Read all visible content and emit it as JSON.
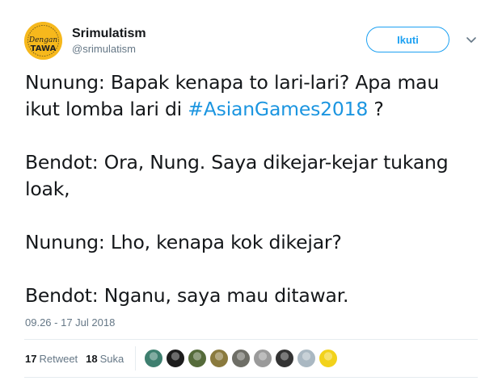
{
  "author": {
    "name": "Srimulatism",
    "handle": "@srimulatism",
    "avatar": {
      "line1": "Dengan",
      "line2": "TAWA",
      "bg": "#f6b81c",
      "ring": "#222222"
    }
  },
  "follow_label": "Ikuti",
  "more_icon": "chevron-down-icon",
  "tweet": {
    "line1": "Nunung: Bapak kenapa to lari-lari? Apa mau",
    "line2_before": "ikut lomba lari di ",
    "hashtag": "#AsianGames2018",
    "line2_after": " ?",
    "p2": "Bendot: Ora, Nung. Saya dikejar-kejar tukang loak,",
    "p3": "Nunung: Lho, kenapa kok dikejar?",
    "p4": "Bendot: Nganu, saya mau ditawar."
  },
  "timestamp": "09.26 - 17 Jul 2018",
  "stats": {
    "retweet_count": "17",
    "retweet_label": "Retweet",
    "like_count": "18",
    "like_label": "Suka"
  },
  "likers": [
    {
      "name": "liker-avatar-1",
      "color": "#3e7f6f"
    },
    {
      "name": "liker-avatar-2",
      "color": "#1c1c1c"
    },
    {
      "name": "liker-avatar-3",
      "color": "#556b3a"
    },
    {
      "name": "liker-avatar-4",
      "color": "#8a7a3e"
    },
    {
      "name": "liker-avatar-5",
      "color": "#6e6e66"
    },
    {
      "name": "liker-avatar-6",
      "color": "#9a9a9a"
    },
    {
      "name": "liker-avatar-7",
      "color": "#333333"
    },
    {
      "name": "liker-avatar-8",
      "color": "#aab8c2"
    },
    {
      "name": "liker-avatar-9",
      "color": "#f2d21b"
    }
  ]
}
